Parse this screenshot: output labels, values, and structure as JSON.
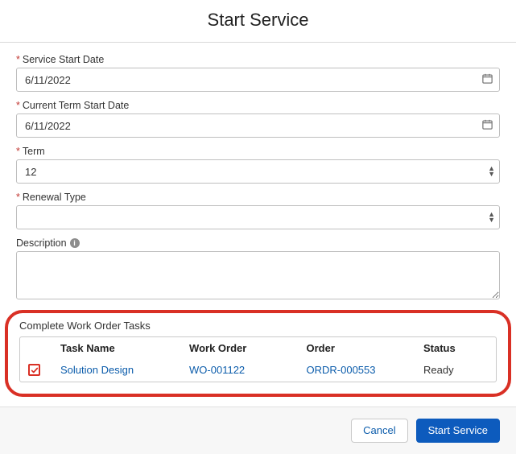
{
  "dialog": {
    "title": "Start Service"
  },
  "fields": {
    "serviceStartDate": {
      "label": "Service Start Date",
      "value": "6/11/2022"
    },
    "currentTermStartDate": {
      "label": "Current Term Start Date",
      "value": "6/11/2022"
    },
    "term": {
      "label": "Term",
      "value": "12"
    },
    "renewalType": {
      "label": "Renewal Type",
      "value": ""
    },
    "description": {
      "label": "Description",
      "value": ""
    }
  },
  "tasksSection": {
    "label": "Complete Work Order Tasks",
    "headers": {
      "taskName": "Task Name",
      "workOrder": "Work Order",
      "order": "Order",
      "status": "Status"
    },
    "rows": [
      {
        "checked": true,
        "taskName": "Solution Design",
        "workOrder": "WO-001122",
        "order": "ORDR-000553",
        "status": "Ready"
      }
    ]
  },
  "footer": {
    "cancel": "Cancel",
    "startService": "Start Service"
  }
}
